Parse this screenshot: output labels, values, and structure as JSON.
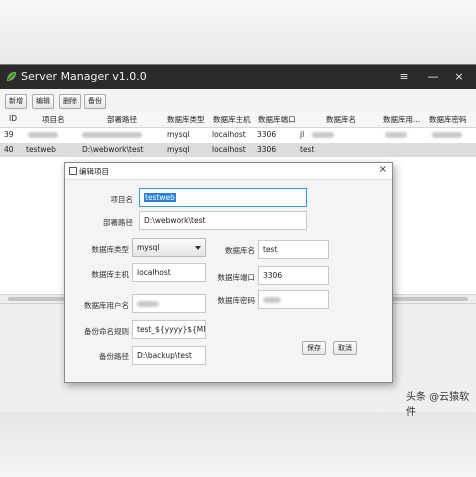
{
  "window": {
    "title": "Server Manager v1.0.0",
    "menu_icon": "≡",
    "close_icon": "×"
  },
  "toolbar": {
    "new_label": "新增",
    "edit_label": "编辑",
    "delete_label": "删除",
    "backup_label": "备份"
  },
  "table": {
    "headers": [
      "ID",
      "项目名",
      "部署路径",
      "数据库类型",
      "数据库主机",
      "数据库端口",
      "数据库名",
      "数据库用...",
      "数据库密码"
    ],
    "rows": [
      {
        "id": "39",
        "project": "",
        "path": "",
        "db_type": "mysql",
        "db_host": "localhost",
        "db_port": "3306",
        "db_name": "jl"
      },
      {
        "id": "40",
        "project": "testweb",
        "path": "D:\\webwork\\test",
        "db_type": "mysql",
        "db_host": "localhost",
        "db_port": "3306",
        "db_name": "test"
      }
    ]
  },
  "dialog": {
    "title": "编辑项目",
    "close_icon": "×",
    "project_name_label": "项目名",
    "project_name_value": "testweb",
    "deploy_path_label": "部署路径",
    "deploy_path_value": "D:\\webwork\\test",
    "db_type_label": "数据库类型",
    "db_type_value": "mysql",
    "db_name_label": "数据库名",
    "db_name_value": "test",
    "db_host_label": "数据库主机",
    "db_host_value": "localhost",
    "db_port_label": "数据库端口",
    "db_port_value": "3306",
    "db_user_label": "数据库用户名",
    "db_password_label": "数据库密码",
    "backup_rule_label": "备份命名规则",
    "backup_rule_value": "test_${yyyy}${MM",
    "backup_path_label": "备份路径",
    "backup_path_value": "D:\\backup\\test",
    "save_label": "保存",
    "cancel_label": "取消"
  },
  "watermark": "头条 @云猿软件",
  "colors": {
    "titlebar": "#2b2b2b",
    "focus": "#2f9fd9",
    "selection": "#2a7fd4",
    "leaf": "#6ab04c"
  }
}
